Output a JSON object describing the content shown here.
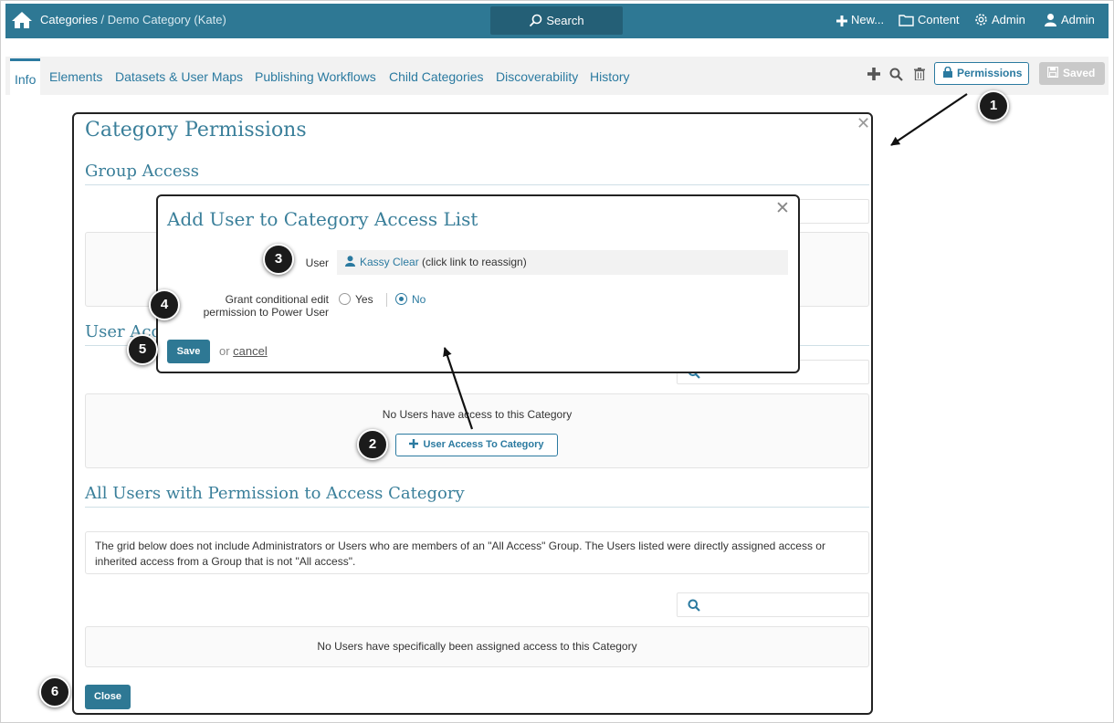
{
  "topbar": {
    "breadcrumb_root": "Categories",
    "breadcrumb_sep": " / ",
    "breadcrumb_current": "Demo Category (Kate)",
    "search_label": "Search",
    "new_label": "New...",
    "content_label": "Content",
    "admin_label": "Admin",
    "user_label": "Admin",
    "icons": [
      "home-icon",
      "search-icon",
      "plus-icon",
      "folder-icon",
      "gear-icon",
      "user-icon"
    ]
  },
  "tabs": {
    "items": [
      {
        "label": "Info",
        "active": true
      },
      {
        "label": "Elements"
      },
      {
        "label": "Datasets & User Maps"
      },
      {
        "label": "Publishing Workflows"
      },
      {
        "label": "Child Categories"
      },
      {
        "label": "Discoverability"
      },
      {
        "label": "History"
      }
    ],
    "permissions_label": "Permissions",
    "saved_label": "Saved",
    "icons": [
      "plus-icon",
      "search-icon",
      "trash-icon",
      "lock-icon",
      "save-icon"
    ]
  },
  "permissions_modal": {
    "title": "Category Permissions",
    "group_access_title": "Group Access",
    "user_access_title": "User Access",
    "no_users_text": "No Users have access to this Category",
    "user_access_button": "User Access To Category",
    "all_users_title": "All Users with Permission to Access Category",
    "info_text": "The grid below does not include Administrators or Users who are members of an \"All Access\" Group. The Users listed were directly assigned access or inherited access from a Group that is not \"All access\".",
    "no_assigned_text": "No Users have specifically been assigned access to this Category",
    "close_button": "Close"
  },
  "add_user_modal": {
    "title": "Add User to Category Access List",
    "user_label": "User",
    "user_name": "Kassy Clear",
    "user_hint": " (click link to reassign)",
    "grant_label_line1": "Grant conditional edit",
    "grant_label_line2": "permission to Power User",
    "option_yes": "Yes",
    "option_no": "No",
    "selected_option": "No",
    "save_button": "Save",
    "or_text": "or ",
    "cancel_link": "cancel"
  },
  "markers": [
    "1",
    "2",
    "3",
    "4",
    "5",
    "6"
  ],
  "colors": {
    "topbar": "#2e7894",
    "accent": "#2b7aa0",
    "heading": "#3a7f9a"
  }
}
